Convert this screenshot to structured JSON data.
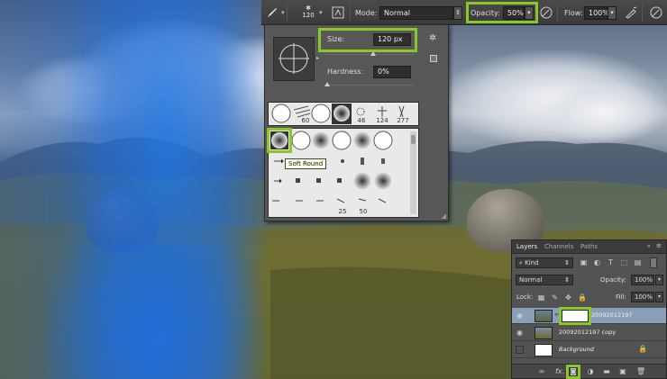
{
  "options_bar": {
    "brush_size": "120",
    "mode_label": "Mode:",
    "mode_value": "Normal",
    "opacity_label": "Opacity:",
    "opacity_value": "50%",
    "flow_label": "Flow:",
    "flow_value": "100%"
  },
  "brush_picker": {
    "size_label": "Size:",
    "size_value": "120 px",
    "hardness_label": "Hardness:",
    "hardness_value": "0%",
    "tooltip": "Soft Round",
    "top_strip_numbers": [
      "60",
      "46",
      "124",
      "277"
    ],
    "grid_numbers": [
      "25",
      "50"
    ]
  },
  "layers_panel": {
    "tabs": [
      "Layers",
      "Channels",
      "Paths"
    ],
    "filter_kind": "Kind",
    "blend_mode": "Normal",
    "opacity_label": "Opacity:",
    "opacity_value": "100%",
    "lock_label": "Lock:",
    "fill_label": "Fill:",
    "fill_value": "100%",
    "layers": [
      {
        "name": "20092012197",
        "selected": true,
        "visible": true,
        "has_mask": true
      },
      {
        "name": "20092012197 copy",
        "selected": false,
        "visible": true,
        "has_mask": false
      },
      {
        "name": "Background",
        "selected": false,
        "visible": false,
        "has_mask": false,
        "locked": true
      }
    ],
    "footer_fx": "fx."
  },
  "colors": {
    "highlight": "#8ac82a",
    "panel_bg": "#535353",
    "selected_layer": "#8aa0b8"
  }
}
